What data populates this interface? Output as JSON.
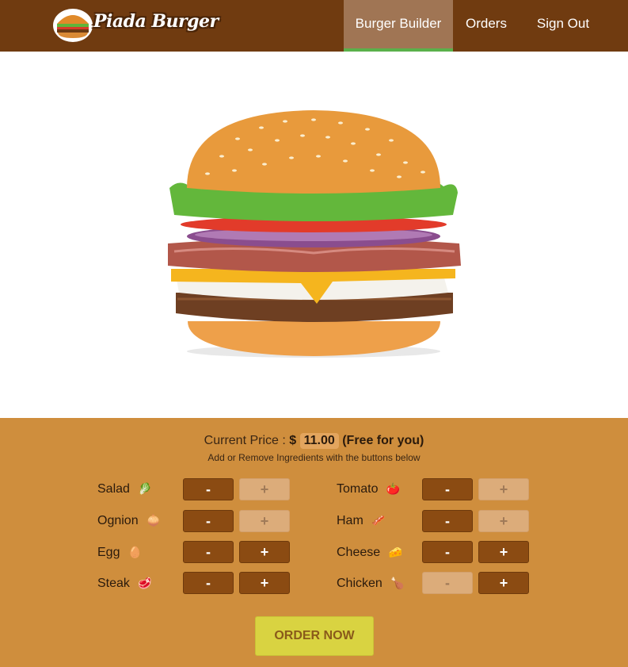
{
  "header": {
    "logo_text": "Piada Burger",
    "nav": [
      {
        "label": "Burger Builder",
        "active": true
      },
      {
        "label": "Orders",
        "active": false
      },
      {
        "label": "Sign Out",
        "active": false
      }
    ]
  },
  "burger": {
    "layers_top_to_bottom": [
      "bun-top",
      "salad",
      "tomato",
      "onion",
      "ham",
      "cheese",
      "egg",
      "steak",
      "bun-bottom"
    ]
  },
  "builder": {
    "price_label": "Current Price :",
    "currency": "$",
    "price": "11.00",
    "free_note": "(Free for you)",
    "hint": "Add or Remove Ingredients with the buttons below",
    "minus_label": "-",
    "plus_label": "+",
    "order_label": "ORDER NOW",
    "ingredients": [
      {
        "label": "Salad",
        "icon": "salad-icon",
        "minus_enabled": true,
        "plus_enabled": false
      },
      {
        "label": "Ognion",
        "icon": "onion-icon",
        "minus_enabled": true,
        "plus_enabled": false
      },
      {
        "label": "Egg",
        "icon": "egg-icon",
        "minus_enabled": true,
        "plus_enabled": true
      },
      {
        "label": "Steak",
        "icon": "steak-icon",
        "minus_enabled": true,
        "plus_enabled": true
      },
      {
        "label": "Tomato",
        "icon": "tomato-icon",
        "minus_enabled": true,
        "plus_enabled": false
      },
      {
        "label": "Ham",
        "icon": "ham-icon",
        "minus_enabled": true,
        "plus_enabled": false
      },
      {
        "label": "Cheese",
        "icon": "cheese-icon",
        "minus_enabled": true,
        "plus_enabled": true
      },
      {
        "label": "Chicken",
        "icon": "chicken-icon",
        "minus_enabled": false,
        "plus_enabled": true
      }
    ]
  },
  "colors": {
    "header_bg": "#703b10",
    "nav_active_bg": "#a07554",
    "nav_active_underline": "#5ab04a",
    "panel_bg": "#cf8e3d",
    "button_enabled": "#8b4b12",
    "button_disabled": "#dcac7a",
    "order_button": "#d9d341"
  }
}
